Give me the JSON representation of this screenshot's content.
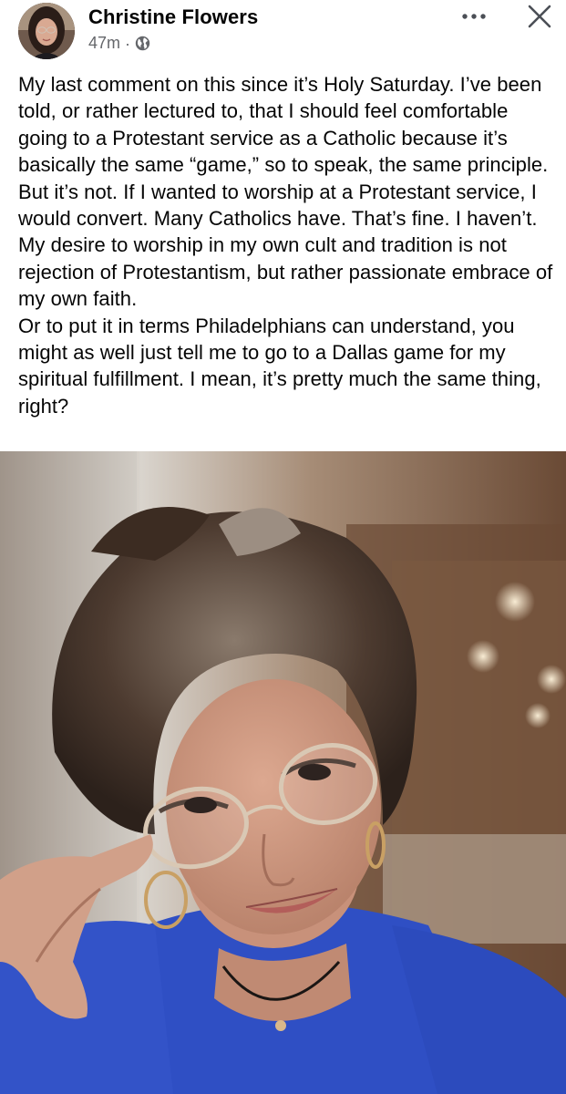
{
  "post": {
    "author_name": "Christine Flowers",
    "timestamp": "47m",
    "separator": "·",
    "privacy_icon": "globe-icon",
    "more_icon": "more-horizontal-icon",
    "close_icon": "close-icon",
    "avatar_icon": "profile-photo",
    "body_paragraph_1": "My last comment on this since it’s Holy Saturday. I’ve been told, or rather lectured to, that I should feel comfortable going to a Protestant service as a Catholic because it’s basically the same “game,” so to speak, the same principle. But it’s not. If I wanted to worship at a Protestant service, I would convert. Many Catholics have. That’s fine. I haven’t. My desire to worship in my own cult and tradition is not rejection of Protestantism, but rather passionate embrace of my own faith.",
    "body_paragraph_2": "Or to put it in terms Philadelphians can understand, you might as well just tell me to go to a Dallas game for my spiritual fulfillment. I mean, it’s pretty much the same thing, right?",
    "photo_subject": "selfie-photo"
  },
  "colors": {
    "text_primary": "#050505",
    "text_secondary": "#65676b",
    "icon": "#4b4f56",
    "shirt_blue": "#2f4fc4"
  }
}
